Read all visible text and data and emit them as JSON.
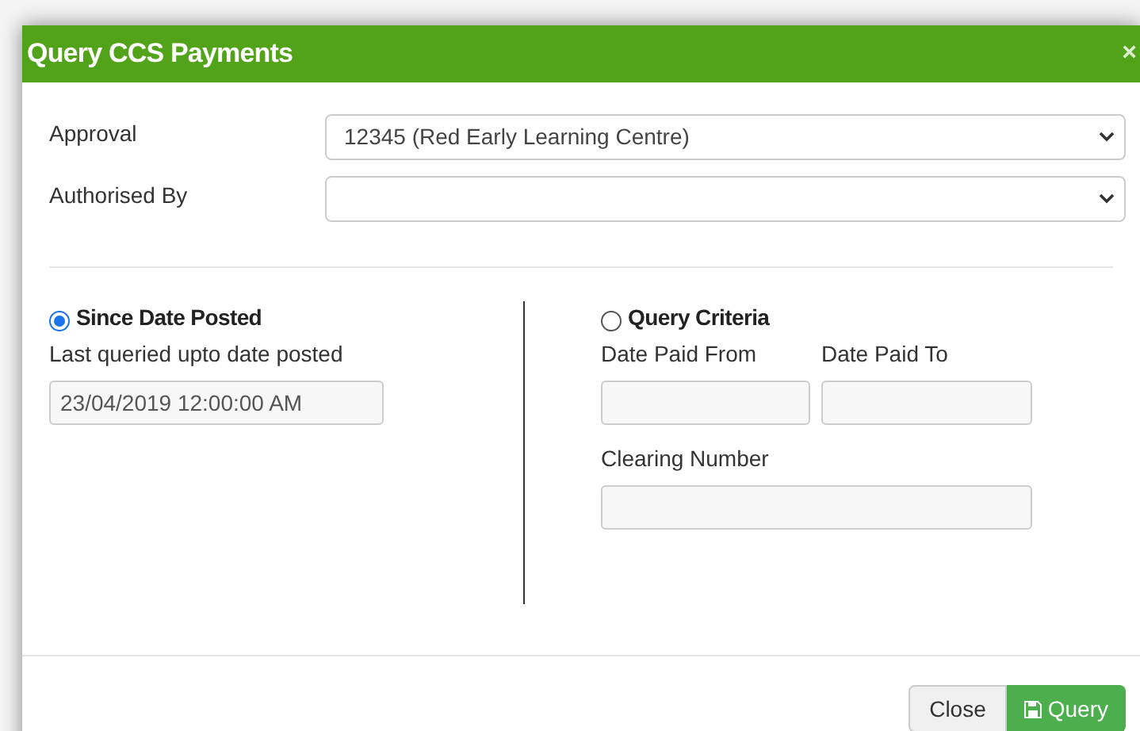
{
  "dialog": {
    "title": "Query CCS Payments",
    "close": "×"
  },
  "fields": [
    {
      "label": "Approval",
      "value": "12345 (Red Early Learning Centre)"
    },
    {
      "label": "Authorised By"
    }
  ],
  "options": [
    {
      "label": "Since Date Posted",
      "selected": true
    },
    {
      "label": "Query Criteria",
      "selected": false
    }
  ],
  "since": {
    "label": "Last queried upto date posted",
    "value": "23/04/2019 12:00:00 AM"
  },
  "criteria": {
    "from_label": "Date Paid From",
    "to_label": "Date Paid To",
    "clearing_label": "Clearing Number"
  },
  "buttons": {
    "close": "Close",
    "query": "Query"
  }
}
